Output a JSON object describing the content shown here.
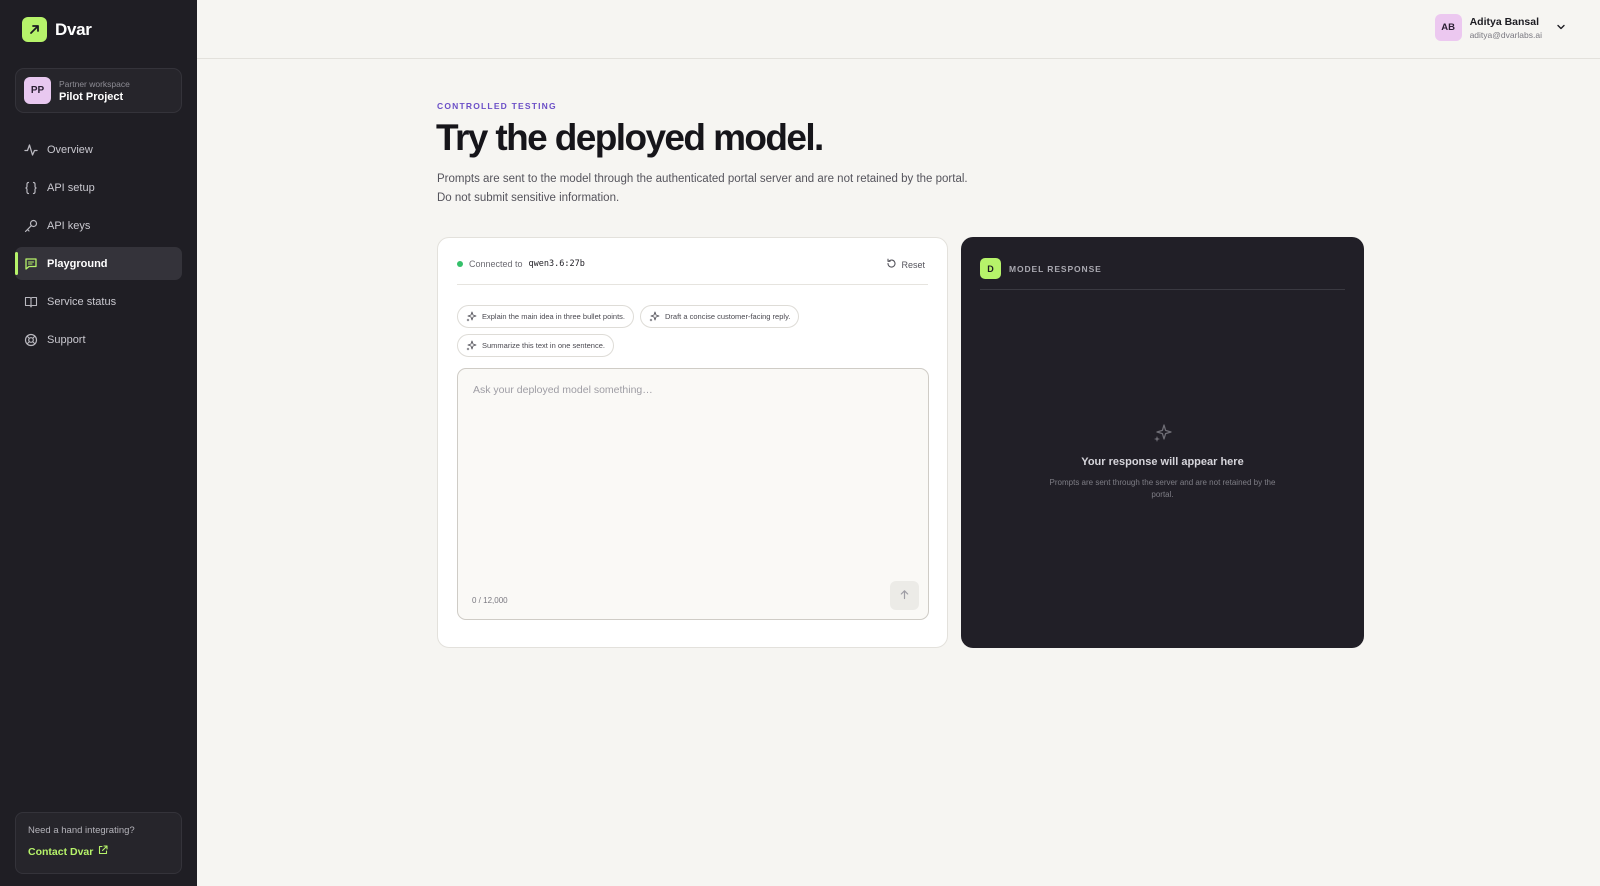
{
  "app": {
    "name": "Dvar",
    "accent_color": "#b6f36a"
  },
  "workspace": {
    "avatar": "PP",
    "caption": "Partner workspace",
    "name": "Pilot Project"
  },
  "sidebar": {
    "items": [
      {
        "label": "Overview",
        "icon": "activity-icon",
        "active": false
      },
      {
        "label": "API setup",
        "icon": "braces-icon",
        "active": false
      },
      {
        "label": "API keys",
        "icon": "key-icon",
        "active": false
      },
      {
        "label": "Playground",
        "icon": "chat-icon",
        "active": true
      },
      {
        "label": "Service status",
        "icon": "book-icon",
        "active": false
      },
      {
        "label": "Support",
        "icon": "lifebuoy-icon",
        "active": false
      }
    ],
    "help": {
      "question": "Need a hand integrating?",
      "link": "Contact Dvar"
    }
  },
  "user": {
    "initials": "AB",
    "name": "Aditya Bansal",
    "email": "aditya@dvarlabs.ai"
  },
  "header": {
    "eyebrow": "CONTROLLED TESTING",
    "title": "Try the deployed model.",
    "desc_line1": "Prompts are sent to the model through the authenticated portal server and are not retained by the portal.",
    "desc_line2": "Do not submit sensitive information."
  },
  "prompt_panel": {
    "connected_label": "Connected to",
    "model": "qwen3.6:27b",
    "reset_label": "Reset",
    "suggestions": [
      "Explain the main idea in three bullet points.",
      "Draft a concise customer-facing reply.",
      "Summarize this text in one sentence."
    ],
    "placeholder": "Ask your deployed model something…",
    "value": "",
    "counter": "0 / 12,000"
  },
  "response_panel": {
    "badge": "D",
    "label": "MODEL RESPONSE",
    "empty_title": "Your response will appear here",
    "empty_subtitle": "Prompts are sent through the server and are not retained by the portal."
  }
}
